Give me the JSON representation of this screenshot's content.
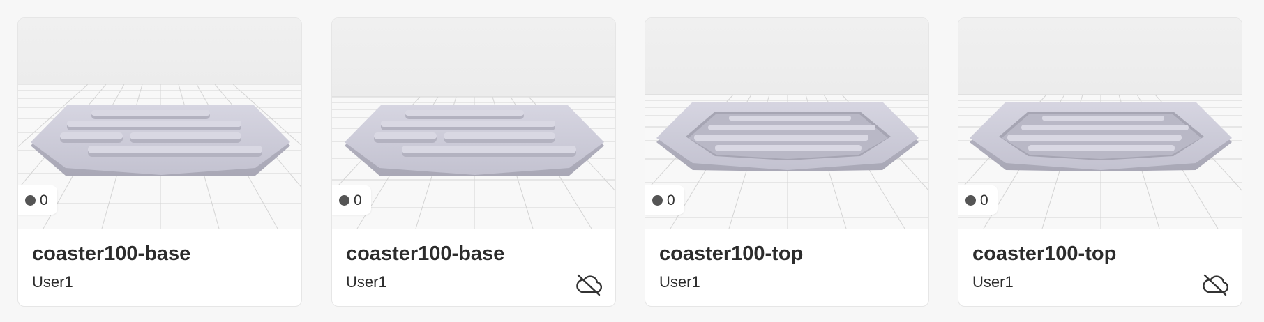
{
  "cards": [
    {
      "title": "coaster100-base",
      "owner": "User1",
      "count": "0",
      "status_icon": "none"
    },
    {
      "title": "coaster100-base",
      "owner": "User1",
      "count": "0",
      "status_icon": "cloud-off-icon"
    },
    {
      "title": "coaster100-top",
      "owner": "User1",
      "count": "0",
      "status_icon": "none"
    },
    {
      "title": "coaster100-top",
      "owner": "User1",
      "count": "0",
      "status_icon": "cloud-off-icon"
    }
  ],
  "colors": {
    "page_bg": "#f7f7f7",
    "card_bg": "#ffffff",
    "model_color": "#c9c8d6",
    "grid_line": "#d2d2d2",
    "badge_dot": "#555555"
  }
}
